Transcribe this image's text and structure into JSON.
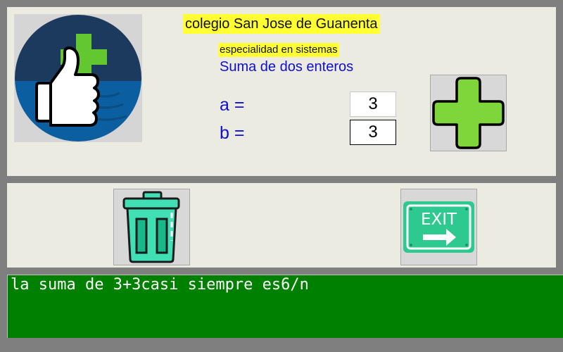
{
  "header": {
    "school_title": "colegio San Jose de Guanenta",
    "specialty": "especialidad en sistemas",
    "subtitle": "Suma de dos enteros"
  },
  "form": {
    "a_label": "a =",
    "a_value": "3",
    "b_label": "b =",
    "b_value": "3"
  },
  "buttons": {
    "add_icon": "plus-icon",
    "clear_icon": "trash-icon",
    "exit_icon": "exit-sign-icon",
    "exit_sign_text": "EXIT"
  },
  "output": {
    "text": "la suma de 3+3casi siempre es6/n"
  },
  "colors": {
    "background": "#7f7f7f",
    "panel": "#ecebe1",
    "highlight": "#ffff33",
    "label_blue": "#0f0fd0",
    "output_bg": "#008000",
    "plus_green": "#7ed63a",
    "exit_green": "#2ec98e",
    "trash_teal": "#41e0b4"
  }
}
